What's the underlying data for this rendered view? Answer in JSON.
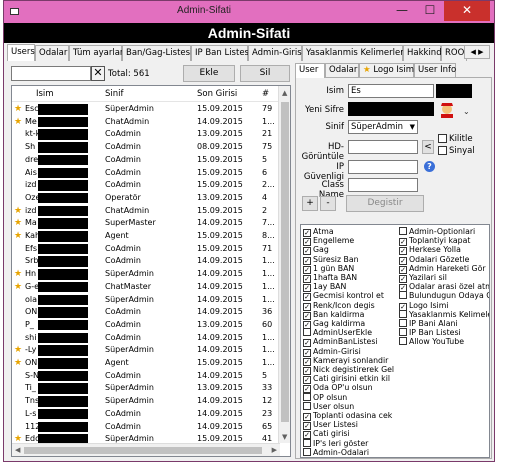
{
  "window": {
    "title": "Admin-Sifati",
    "header": "Admin-Sifati",
    "min": "—",
    "max": "☐",
    "close": "✕"
  },
  "tabs": [
    "Users",
    "Odalar",
    "Tüm ayarlar",
    "Ban/Gag-Listesi",
    "IP Ban Listesi",
    "Admin-Girisi",
    "Yasaklanmis Kelimerler",
    "Hakkinda",
    "ROOT"
  ],
  "tab_arrows": "◀ ▶",
  "toolbar": {
    "clear": "✕",
    "total": "Total: 561",
    "add": "Ekle",
    "delete": "Sil"
  },
  "table": {
    "columns": [
      "Isim",
      "Sinif",
      "Son Girisi",
      "#"
    ],
    "rows": [
      {
        "star": true,
        "name": "Esc",
        "cls": "SüperAdmin",
        "date": "15.09.2015",
        "n": "79"
      },
      {
        "star": true,
        "name": "Me",
        "cls": "ChatAdmin",
        "date": "14.09.2015",
        "n": "1..."
      },
      {
        "star": false,
        "name": "kt-k",
        "cls": "CoAdmin",
        "date": "13.09.2015",
        "n": "21"
      },
      {
        "star": false,
        "name": "Sh",
        "cls": "CoAdmin",
        "date": "08.09.2015",
        "n": "75"
      },
      {
        "star": false,
        "name": "dre",
        "cls": "CoAdmin",
        "date": "15.09.2015",
        "n": "5"
      },
      {
        "star": false,
        "name": "Ais",
        "cls": "CoAdmin",
        "date": "15.09.2015",
        "n": "6"
      },
      {
        "star": false,
        "name": "izd",
        "cls": "CoAdmin",
        "date": "15.09.2015",
        "n": "2..."
      },
      {
        "star": false,
        "name": "Oze",
        "cls": "Operatör",
        "date": "13.09.2015",
        "n": "4"
      },
      {
        "star": true,
        "name": "izd",
        "cls": "ChatAdmin",
        "date": "15.09.2015",
        "n": "2"
      },
      {
        "star": true,
        "name": "Ma",
        "cls": "SuperMaster",
        "date": "14.09.2015",
        "n": "7..."
      },
      {
        "star": true,
        "name": "Kah",
        "cls": "Agent",
        "date": "15.09.2015",
        "n": "8..."
      },
      {
        "star": false,
        "name": "Efs",
        "cls": "CoAdmin",
        "date": "15.09.2015",
        "n": "71"
      },
      {
        "star": false,
        "name": "Srb",
        "cls": "CoAdmin",
        "date": "14.09.2015",
        "n": "1..."
      },
      {
        "star": true,
        "name": "Hn",
        "cls": "SüperAdmin",
        "date": "14.09.2015",
        "n": "1..."
      },
      {
        "star": true,
        "name": "G-e",
        "cls": "ChatMaster",
        "date": "14.09.2015",
        "n": "1..."
      },
      {
        "star": false,
        "name": "ola",
        "cls": "SüperAdmin",
        "date": "14.09.2015",
        "n": "1..."
      },
      {
        "star": false,
        "name": "ON",
        "cls": "CoAdmin",
        "date": "14.09.2015",
        "n": "36"
      },
      {
        "star": false,
        "name": "P_",
        "cls": "CoAdmin",
        "date": "13.09.2015",
        "n": "60"
      },
      {
        "star": false,
        "name": "shi",
        "cls": "CoAdmin",
        "date": "14.09.2015",
        "n": "1..."
      },
      {
        "star": true,
        "name": "-Ly",
        "cls": "SüperAdmin",
        "date": "14.09.2015",
        "n": "1..."
      },
      {
        "star": true,
        "name": "ON",
        "cls": "Agent",
        "date": "15.09.2015",
        "n": "1..."
      },
      {
        "star": false,
        "name": "S-N",
        "cls": "CoAdmin",
        "date": "14.09.2015",
        "n": "5"
      },
      {
        "star": false,
        "name": "Ti_",
        "cls": "SüperAdmin",
        "date": "13.09.2015",
        "n": "33"
      },
      {
        "star": false,
        "name": "Tns",
        "cls": "SüperAdmin",
        "date": "14.09.2015",
        "n": "12"
      },
      {
        "star": false,
        "name": "L-s",
        "cls": "CoAdmin",
        "date": "14.09.2015",
        "n": "23"
      },
      {
        "star": false,
        "name": "112",
        "cls": "CoAdmin",
        "date": "14.09.2015",
        "n": "65"
      },
      {
        "star": true,
        "name": "Edo",
        "cls": "SüperAdmin",
        "date": "15.09.2015",
        "n": "41"
      }
    ]
  },
  "right_tabs": [
    "User",
    "Odalar",
    "Logo Isimi",
    "User Info"
  ],
  "user_form": {
    "name_label": "Isim",
    "name_value": "Es",
    "password_label": "Yeni Sifre",
    "class_label": "Sinif",
    "class_value": "SüperAdmin",
    "hd_label": "HD-Görüntüle",
    "hd_btn": "<",
    "lock_label": "Kilitle",
    "signal_label": "Sinyal",
    "ip_label": "IP Güvenligi",
    "help": "?",
    "classname_label": "Class Name",
    "plus": "+",
    "minus": "-",
    "change": "Degistir"
  },
  "permissions_left": [
    {
      "label": "Atma",
      "checked": true
    },
    {
      "label": "Engelleme",
      "checked": true
    },
    {
      "label": "Gag",
      "checked": true
    },
    {
      "label": "Süresiz Ban",
      "checked": true
    },
    {
      "label": "1 gün BAN",
      "checked": true
    },
    {
      "label": "1hafta BAN",
      "checked": true
    },
    {
      "label": "1ay BAN",
      "checked": true
    },
    {
      "label": "Gecmisi kontrol et",
      "checked": true
    },
    {
      "label": "Renk/Icon degis",
      "checked": true
    },
    {
      "label": "Ban kaldirma",
      "checked": true
    },
    {
      "label": "Gag kaldirma",
      "checked": true
    },
    {
      "label": "AdminUserEkle",
      "checked": false
    },
    {
      "label": "AdminBanListesi",
      "checked": true
    },
    {
      "label": "Admin-Girisi",
      "checked": true
    },
    {
      "label": "Kamerayi sonlandir",
      "checked": true
    },
    {
      "label": "Nick degistirerek Gel",
      "checked": true
    },
    {
      "label": "Cati girisini etkin kil",
      "checked": true
    },
    {
      "label": "Oda OP'u olsun",
      "checked": true
    },
    {
      "label": "OP olsun",
      "checked": false
    },
    {
      "label": "User olsun",
      "checked": false
    },
    {
      "label": "Toplanti odasina cek",
      "checked": true
    },
    {
      "label": "User Listesi",
      "checked": true
    },
    {
      "label": "Cati girisi",
      "checked": true
    },
    {
      "label": "IP's leri göster",
      "checked": false
    },
    {
      "label": "Admin-Odalari",
      "checked": false
    }
  ],
  "permissions_right": [
    {
      "label": "Admin-Optionlari",
      "checked": false
    },
    {
      "label": "Toplantiyi kapat",
      "checked": true
    },
    {
      "label": "Herkese Yolla",
      "checked": true
    },
    {
      "label": "Odalari Gözetle",
      "checked": true
    },
    {
      "label": "Admin Hareketi Gör",
      "checked": true
    },
    {
      "label": "Yazilari sil",
      "checked": true
    },
    {
      "label": "Odalar arasi özel atma",
      "checked": true
    },
    {
      "label": "Bulundugun Odaya Cek",
      "checked": false
    },
    {
      "label": "Logo Isimi",
      "checked": true
    },
    {
      "label": "Yasaklanmis Kelimeler",
      "checked": false
    },
    {
      "label": "IP Bani Alani",
      "checked": false
    },
    {
      "label": "IP Ban Listesi",
      "checked": false
    },
    {
      "label": "Allow YouTube",
      "checked": false
    }
  ],
  "colors": {
    "titlebar": "#e26fbf",
    "close": "#c9302c",
    "header": "#000000"
  }
}
